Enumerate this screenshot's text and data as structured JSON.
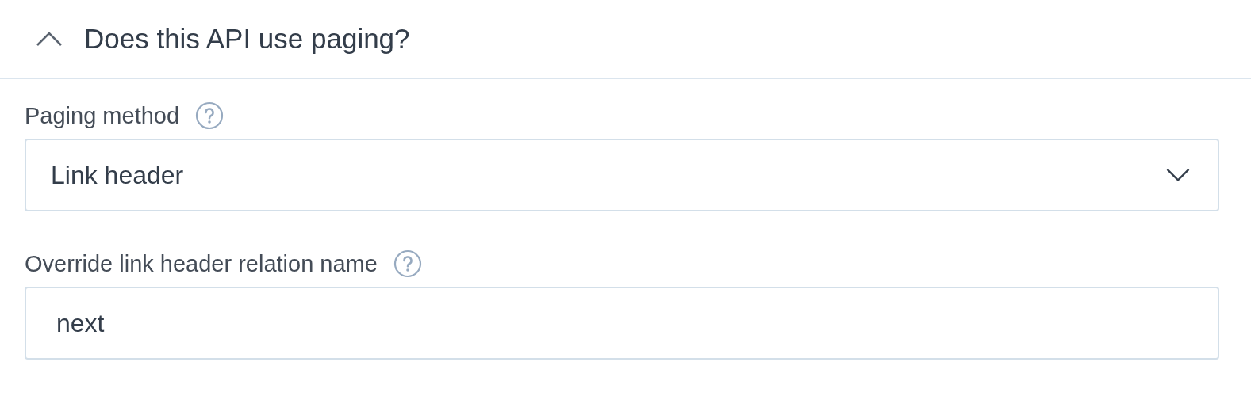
{
  "section": {
    "title": "Does this API use paging?",
    "expanded": true
  },
  "fields": [
    {
      "kind": "select",
      "label": "Paging method",
      "value": "Link header"
    },
    {
      "kind": "text",
      "label": "Override link header relation name",
      "value": "next"
    }
  ]
}
